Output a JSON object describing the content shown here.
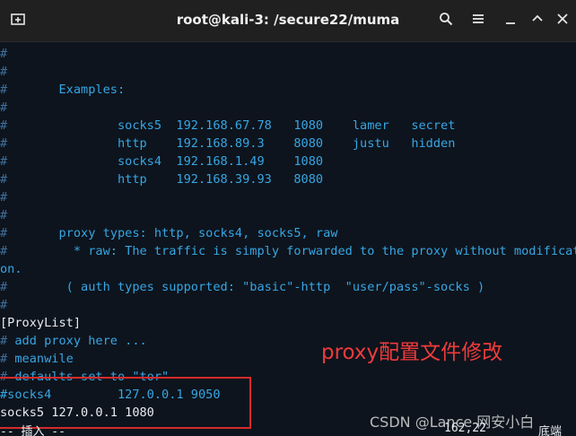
{
  "window": {
    "title": "root@kali-3: /secure22/muma",
    "new_tab_icon": "new-tab-icon",
    "search_icon": "search-icon",
    "menu_icon": "hamburger-menu-icon",
    "minimize_icon": "minimize-icon",
    "maximize_icon": "maximize-icon",
    "close_icon": "close-icon"
  },
  "terminal": {
    "lines": [
      "#",
      "#",
      "#       Examples:",
      "#",
      "#               socks5  192.168.67.78   1080    lamer   secret",
      "#               http    192.168.89.3    8080    justu   hidden",
      "#               socks4  192.168.1.49    1080",
      "#               http    192.168.39.93   8080",
      "#",
      "#",
      "#       proxy types: http, socks4, socks5, raw",
      "#         * raw: The traffic is simply forwarded to the proxy without modificati",
      "on.",
      "#        ( auth types supported: \"basic\"-http  \"user/pass\"-socks )",
      "#",
      "[ProxyList]",
      "# add proxy here ...",
      "# meanwile",
      "# defaults set to \"tor\"",
      "#socks4         127.0.0.1 9050",
      "socks5 127.0.0.1 1080"
    ],
    "status_mode": "-- 插入 --",
    "status_pos": "162,22",
    "status_pct": "底端"
  },
  "annotation": {
    "label": "proxy配置文件修改",
    "color": "#ef3b3b"
  },
  "watermark": "CSDN @Lance 网安小白"
}
